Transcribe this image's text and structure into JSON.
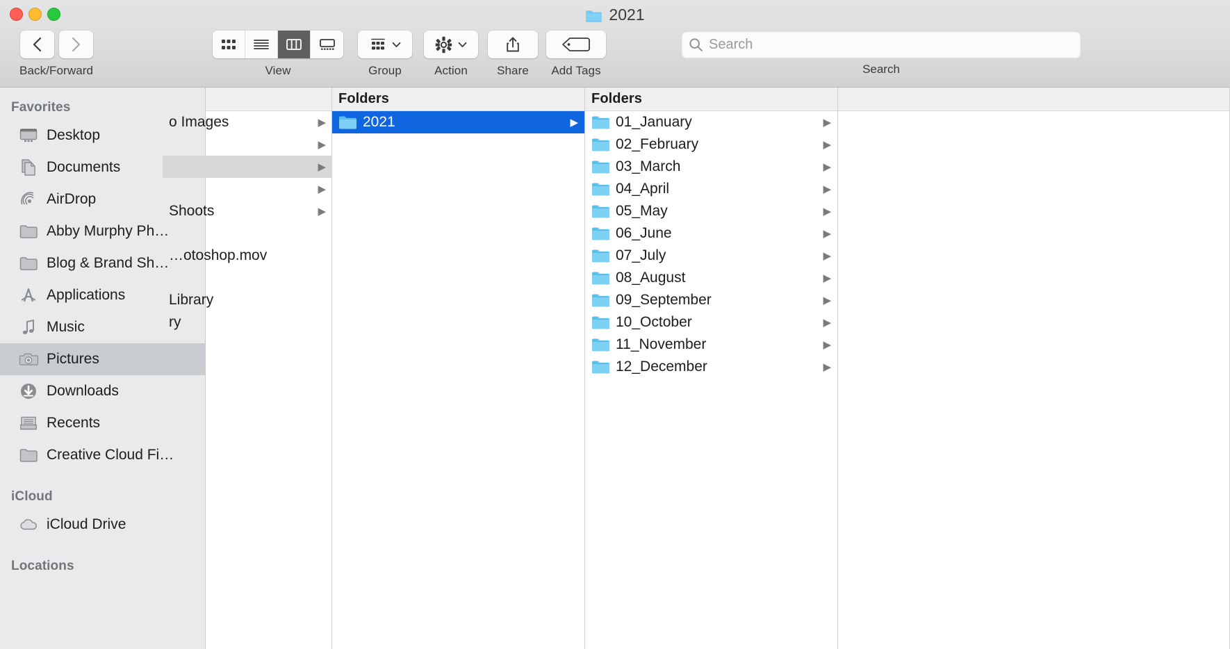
{
  "window": {
    "title": "2021",
    "title_icon": "folder-icon"
  },
  "traffic_lights": {
    "close": "close-button",
    "minimize": "minimize-button",
    "zoom": "zoom-button",
    "colors": {
      "close": "#ff5f57",
      "minimize": "#febc2e",
      "zoom": "#28c840"
    }
  },
  "toolbar": {
    "nav": {
      "label": "Back/Forward",
      "back_icon": "chevron-left-icon",
      "forward_icon": "chevron-right-icon"
    },
    "view": {
      "label": "View",
      "options": [
        {
          "name": "icon-view",
          "icon": "grid-icon",
          "active": false
        },
        {
          "name": "list-view",
          "icon": "list-icon",
          "active": false
        },
        {
          "name": "column-view",
          "icon": "columns-icon",
          "active": true
        },
        {
          "name": "gallery-view",
          "icon": "gallery-icon",
          "active": false
        }
      ]
    },
    "group": {
      "label": "Group",
      "icon": "group-icon",
      "chevron": "chevron-down-icon"
    },
    "action": {
      "label": "Action",
      "icon": "gear-icon",
      "chevron": "chevron-down-icon"
    },
    "share": {
      "label": "Share",
      "icon": "share-icon"
    },
    "tags": {
      "label": "Add Tags",
      "icon": "tag-icon"
    }
  },
  "search": {
    "label": "Search",
    "placeholder": "Search",
    "value": "",
    "icon": "search-icon"
  },
  "sidebar": {
    "sections": [
      {
        "header": "Favorites",
        "items": [
          {
            "label": "Desktop",
            "icon": "desktop-icon",
            "selected": false
          },
          {
            "label": "Documents",
            "icon": "documents-icon",
            "selected": false
          },
          {
            "label": "AirDrop",
            "icon": "airdrop-icon",
            "selected": false
          },
          {
            "label": "Abby Murphy Ph…",
            "icon": "folder-icon",
            "selected": false
          },
          {
            "label": "Blog & Brand Sh…",
            "icon": "folder-icon",
            "selected": false
          },
          {
            "label": "Applications",
            "icon": "applications-icon",
            "selected": false
          },
          {
            "label": "Music",
            "icon": "music-icon",
            "selected": false
          },
          {
            "label": "Pictures",
            "icon": "pictures-icon",
            "selected": true
          },
          {
            "label": "Downloads",
            "icon": "downloads-icon",
            "selected": false
          },
          {
            "label": "Recents",
            "icon": "recents-icon",
            "selected": false
          },
          {
            "label": "Creative Cloud Fi…",
            "icon": "folder-icon",
            "selected": false
          }
        ]
      },
      {
        "header": "iCloud",
        "items": [
          {
            "label": "iCloud Drive",
            "icon": "cloud-icon",
            "selected": false
          }
        ]
      },
      {
        "header": "Locations",
        "items": []
      }
    ]
  },
  "columns": [
    {
      "name": "column-1",
      "header": "",
      "clipped": true,
      "items": [
        {
          "label": "o Images",
          "arrow": true,
          "selected": false,
          "highlighted": false
        },
        {
          "label": "",
          "arrow": true,
          "selected": false,
          "highlighted": false
        },
        {
          "label": "",
          "arrow": true,
          "selected": false,
          "highlighted": true
        },
        {
          "label": "",
          "arrow": true,
          "selected": false,
          "highlighted": false
        },
        {
          "label": "Shoots",
          "arrow": true,
          "selected": false,
          "highlighted": false
        },
        {
          "label": "",
          "arrow": false,
          "selected": false,
          "highlighted": false
        },
        {
          "label": "…otoshop.mov",
          "arrow": false,
          "selected": false,
          "highlighted": false
        },
        {
          "label": "",
          "arrow": false,
          "selected": false,
          "highlighted": false
        },
        {
          "label": "Library",
          "arrow": false,
          "selected": false,
          "highlighted": false
        },
        {
          "label": "ry",
          "arrow": false,
          "selected": false,
          "highlighted": false
        }
      ]
    },
    {
      "name": "column-2",
      "header": "Folders",
      "clipped": false,
      "items": [
        {
          "label": "2021",
          "icon": "folder-icon",
          "arrow": true,
          "selected": true,
          "highlighted": false
        }
      ]
    },
    {
      "name": "column-3",
      "header": "Folders",
      "clipped": false,
      "items": [
        {
          "label": "01_January",
          "icon": "folder-icon",
          "arrow": true,
          "selected": false,
          "highlighted": false
        },
        {
          "label": "02_February",
          "icon": "folder-icon",
          "arrow": true,
          "selected": false,
          "highlighted": false
        },
        {
          "label": "03_March",
          "icon": "folder-icon",
          "arrow": true,
          "selected": false,
          "highlighted": false
        },
        {
          "label": "04_April",
          "icon": "folder-icon",
          "arrow": true,
          "selected": false,
          "highlighted": false
        },
        {
          "label": "05_May",
          "icon": "folder-icon",
          "arrow": true,
          "selected": false,
          "highlighted": false
        },
        {
          "label": "06_June",
          "icon": "folder-icon",
          "arrow": true,
          "selected": false,
          "highlighted": false
        },
        {
          "label": "07_July",
          "icon": "folder-icon",
          "arrow": true,
          "selected": false,
          "highlighted": false
        },
        {
          "label": "08_August",
          "icon": "folder-icon",
          "arrow": true,
          "selected": false,
          "highlighted": false
        },
        {
          "label": "09_September",
          "icon": "folder-icon",
          "arrow": true,
          "selected": false,
          "highlighted": false
        },
        {
          "label": "10_October",
          "icon": "folder-icon",
          "arrow": true,
          "selected": false,
          "highlighted": false
        },
        {
          "label": "11_November",
          "icon": "folder-icon",
          "arrow": true,
          "selected": false,
          "highlighted": false
        },
        {
          "label": "12_December",
          "icon": "folder-icon",
          "arrow": true,
          "selected": false,
          "highlighted": false
        }
      ]
    },
    {
      "name": "column-4-preview",
      "header": "",
      "clipped": false,
      "items": []
    }
  ],
  "colors": {
    "selection_blue": "#1066e0",
    "folder_blue": "#6fc9f2",
    "sidebar_bg": "#e9eaec",
    "toolbar_bg": "#dcdcdc",
    "row_highlight": "#d8d8d8"
  }
}
